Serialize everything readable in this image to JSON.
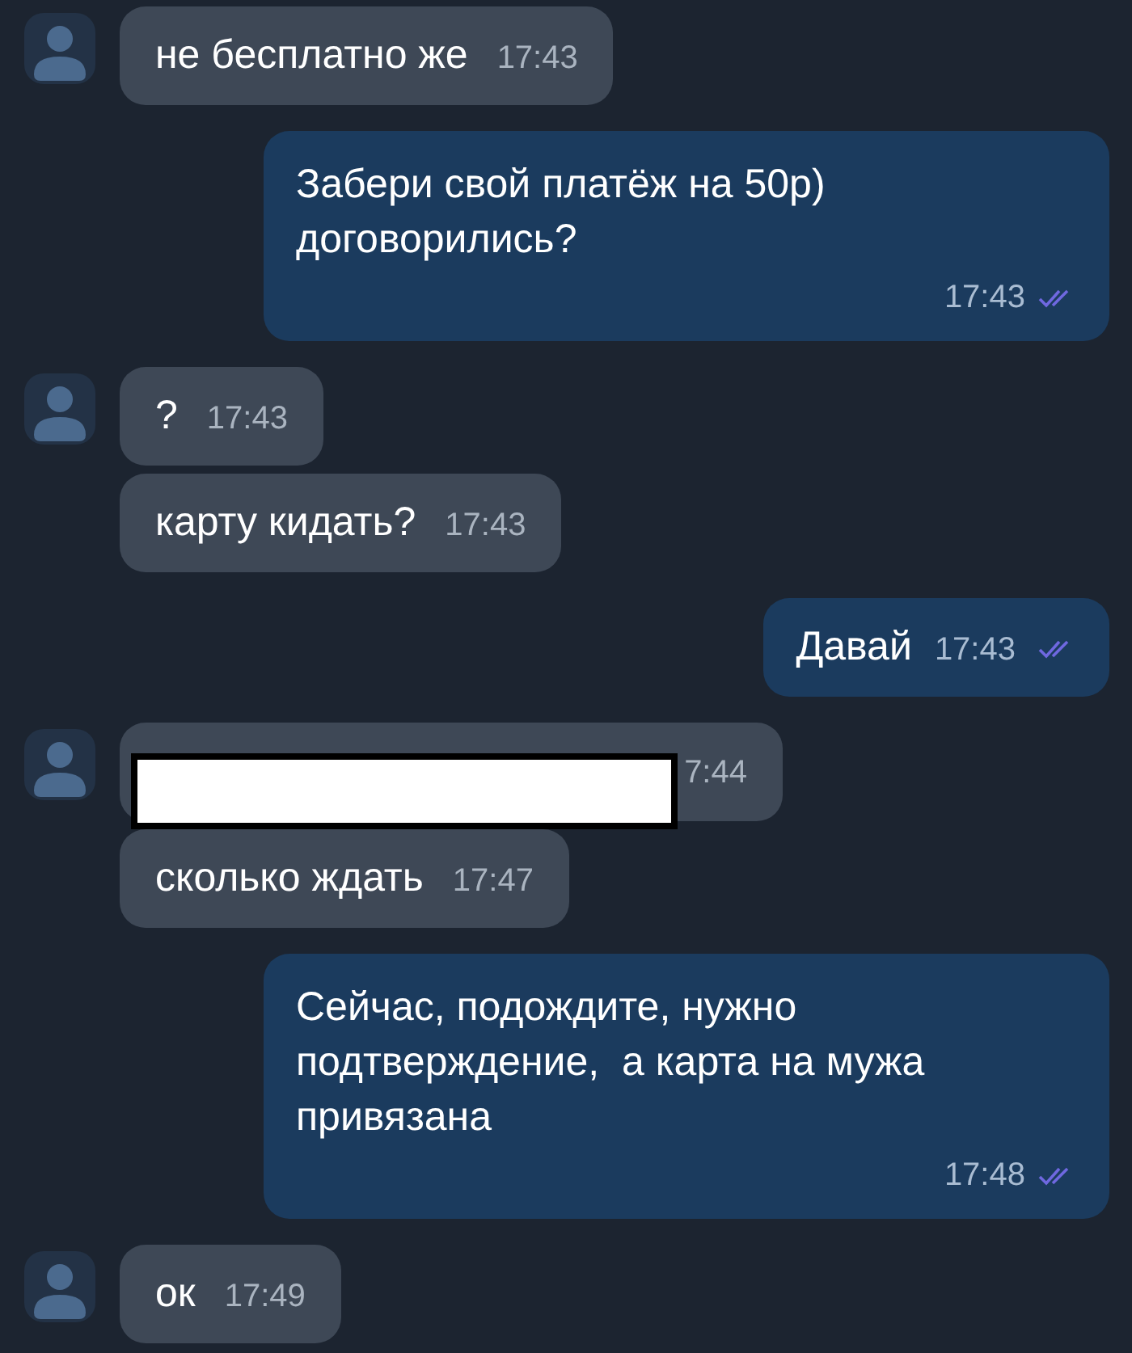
{
  "messages": [
    {
      "kind": "incoming",
      "avatar": true,
      "text": "не бесплатно же",
      "time": "17:43"
    },
    {
      "kind": "outgoing",
      "text": "Забери свой платёж на 50р)\nдоговорились?",
      "time": "17:43",
      "read": true
    },
    {
      "kind": "incoming",
      "avatar": true,
      "text": "?",
      "time": "17:43"
    },
    {
      "kind": "incoming",
      "avatar": false,
      "text": "карту кидать?",
      "time": "17:43"
    },
    {
      "kind": "outgoing",
      "text": "Давай",
      "time": "17:43",
      "read": true
    },
    {
      "kind": "redacted",
      "avatar": true,
      "time": "7:44"
    },
    {
      "kind": "incoming",
      "avatar": false,
      "text": "сколько ждать",
      "time": "17:47"
    },
    {
      "kind": "outgoing",
      "text": "Сейчас, подождите, нужно\nподтверждение,  а карта на мужа\nпривязана",
      "time": "17:48",
      "read": true
    },
    {
      "kind": "incoming",
      "avatar": true,
      "text": "ок",
      "time": "17:49"
    }
  ]
}
